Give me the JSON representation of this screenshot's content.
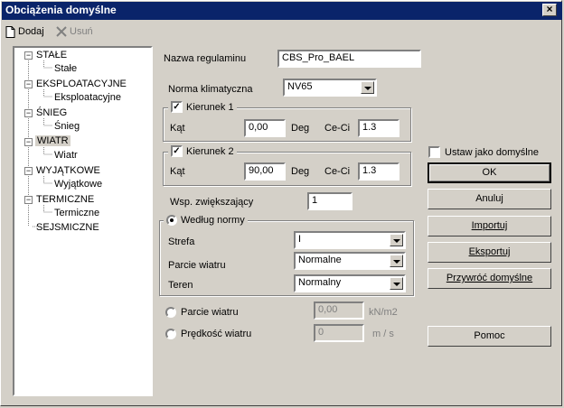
{
  "window": {
    "title": "Obciążenia domyślne",
    "close": "×"
  },
  "toolbar": {
    "add_label": "Dodaj",
    "delete_label": "Usuń"
  },
  "tree": [
    {
      "label": "STAŁE",
      "child": "Stałe"
    },
    {
      "label": "EKSPLOATACYJNE",
      "child": "Eksploatacyjne"
    },
    {
      "label": "ŚNIEG",
      "child": "Śnieg"
    },
    {
      "label": "WIATR",
      "child": "Wiatr"
    },
    {
      "label": "WYJĄTKOWE",
      "child": "Wyjątkowe"
    },
    {
      "label": "TERMICZNE",
      "child": "Termiczne"
    },
    {
      "label": "SEJSMICZNE"
    }
  ],
  "form": {
    "regulation_label": "Nazwa regulaminu",
    "regulation_value": "CBS_Pro_BAEL",
    "climate_label": "Norma klimatyczna",
    "climate_value": "NV65",
    "dir1": {
      "label": "Kierunek 1",
      "angle_label": "Kąt",
      "angle_value": "0,00",
      "unit": "Deg",
      "ceci_label": "Ce-Ci",
      "ceci_value": "1.3"
    },
    "dir2": {
      "label": "Kierunek 2",
      "angle_label": "Kąt",
      "angle_value": "90,00",
      "unit": "Deg",
      "ceci_label": "Ce-Ci",
      "ceci_value": "1.3"
    },
    "coef_label": "Wsp. zwiększający",
    "coef_value": "1",
    "by_norm_label": "Według normy",
    "zone_label": "Strefa",
    "zone_value": "I",
    "pressure_label": "Parcie wiatru",
    "pressure_value": "Normalne",
    "terrain_label": "Teren",
    "terrain_value": "Normalny",
    "wind_pressure_label": "Parcie wiatru",
    "wind_pressure_value": "0,00",
    "wind_pressure_unit": "kN/m2",
    "wind_speed_label": "Prędkość wiatru",
    "wind_speed_value": "0",
    "wind_speed_unit": "m / s"
  },
  "right": {
    "set_default_label": "Ustaw jako domyślne",
    "ok": "OK",
    "cancel": "Anuluj",
    "import": "Importuj",
    "export": "Eksportuj",
    "restore": "Przywróć domyślne",
    "help": "Pomoc"
  }
}
